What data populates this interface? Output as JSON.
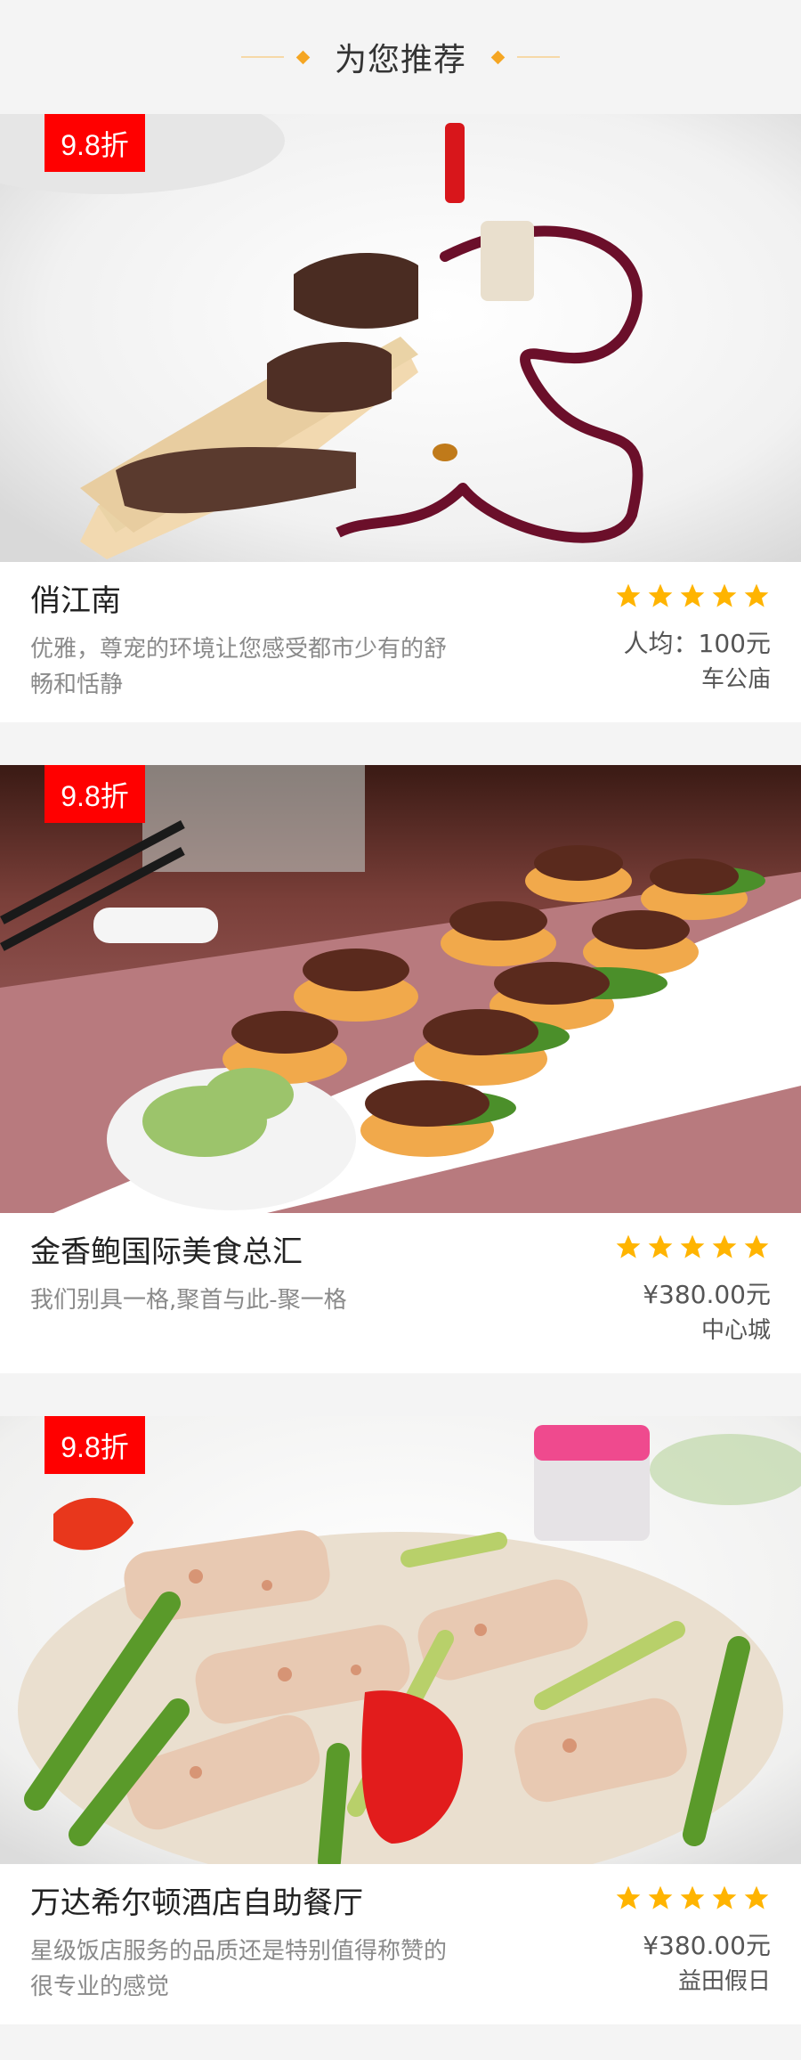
{
  "header": {
    "title": "为您推荐"
  },
  "colors": {
    "accent": "#f5a623",
    "badge": "#ff0000",
    "star": "#ffb400"
  },
  "cards": [
    {
      "discount": "9.8折",
      "photo": "foie-gras-on-toast-photo",
      "name": "俏江南",
      "description": "优雅，尊宠的环境让您感受都市少有的舒畅和恬静",
      "rating": 5,
      "price": "人均：100元",
      "location": "车公庙"
    },
    {
      "discount": "9.8折",
      "photo": "canapes-platter-photo",
      "name": "金香鲍国际美食总汇",
      "description": "我们别具一格,聚首与此-聚一格",
      "rating": 5,
      "price": "¥380.00元",
      "location": "中心城"
    },
    {
      "discount": "9.8折",
      "photo": "stir-fry-lotus-asparagus-photo",
      "name": "万达希尔顿酒店自助餐厅",
      "description": "星级饭店服务的品质还是特别值得称赞的很专业的感觉",
      "rating": 5,
      "price": "¥380.00元",
      "location": "益田假日"
    }
  ]
}
